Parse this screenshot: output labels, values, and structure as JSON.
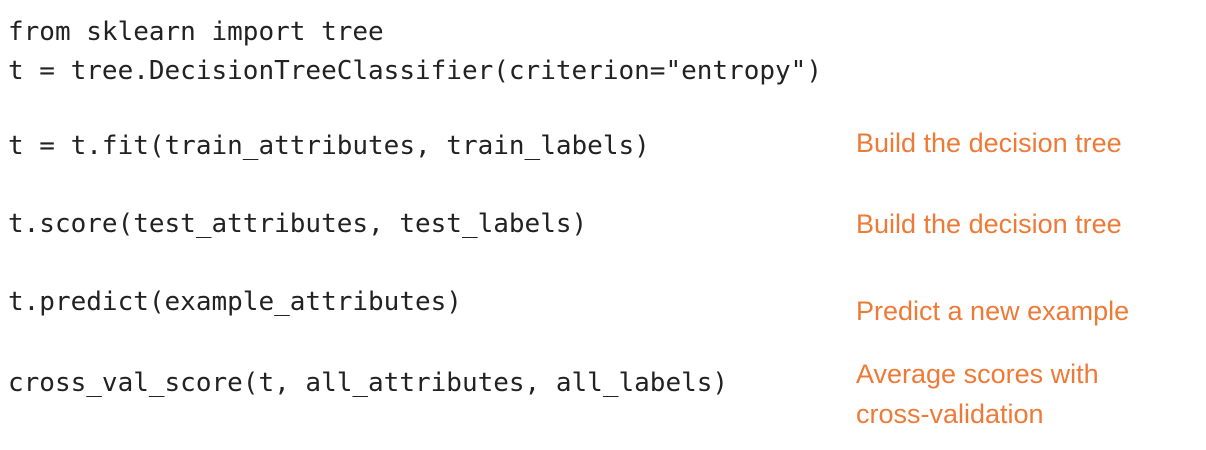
{
  "code": {
    "import_line": "from sklearn import tree",
    "create_line": "t = tree.DecisionTreeClassifier(criterion=\"entropy\")",
    "fit_line": "t = t.fit(train_attributes, train_labels)",
    "score_line": "t.score(test_attributes, test_labels)",
    "predict_line": "t.predict(example_attributes)",
    "cv_line": "cross_val_score(t, all_attributes, all_labels)"
  },
  "notes": {
    "fit_note": "Build the decision tree",
    "score_note": "Build the decision tree",
    "predict_note": "Predict a new example",
    "cv_note_line1": "Average scores with",
    "cv_note_line2": "cross-validation"
  },
  "colors": {
    "code_text": "#222222",
    "annotation": "#ee7a37",
    "background": "#ffffff"
  }
}
